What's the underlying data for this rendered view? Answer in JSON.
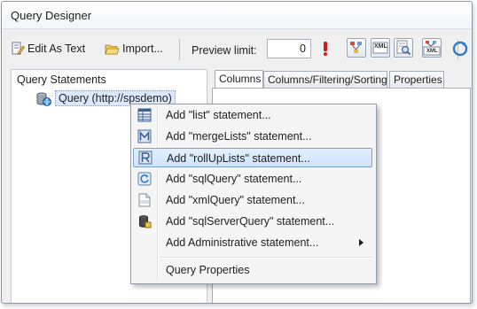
{
  "window": {
    "title": "Query Designer"
  },
  "toolbar": {
    "edit_as_text": "Edit As Text",
    "import": "Import...",
    "preview_limit_label": "Preview limit:",
    "preview_limit_value": "0",
    "xml_icon_text": "XML"
  },
  "left_panel": {
    "header": "Query Statements",
    "node_label": "Query (http://spsdemo)"
  },
  "tabs": [
    {
      "label": "Columns"
    },
    {
      "label": "Columns/Filtering/Sorting"
    },
    {
      "label": "Properties"
    }
  ],
  "context_menu": {
    "items": [
      {
        "label": "Add \"list\" statement...",
        "icon": "list-grid-icon"
      },
      {
        "label": "Add \"mergeLists\" statement...",
        "icon": "merge-lists-icon"
      },
      {
        "label": "Add \"rollUpLists\" statement...",
        "icon": "rollup-lists-icon",
        "highlighted": true
      },
      {
        "label": "Add \"sqlQuery\" statement...",
        "icon": "sql-query-icon"
      },
      {
        "label": "Add \"xmlQuery\" statement...",
        "icon": "xml-query-icon"
      },
      {
        "label": "Add \"sqlServerQuery\" statement...",
        "icon": "sql-server-icon"
      },
      {
        "label": "Add Administrative statement...",
        "icon": "",
        "has_submenu": true
      },
      {
        "label": "Query Properties",
        "icon": ""
      }
    ]
  }
}
